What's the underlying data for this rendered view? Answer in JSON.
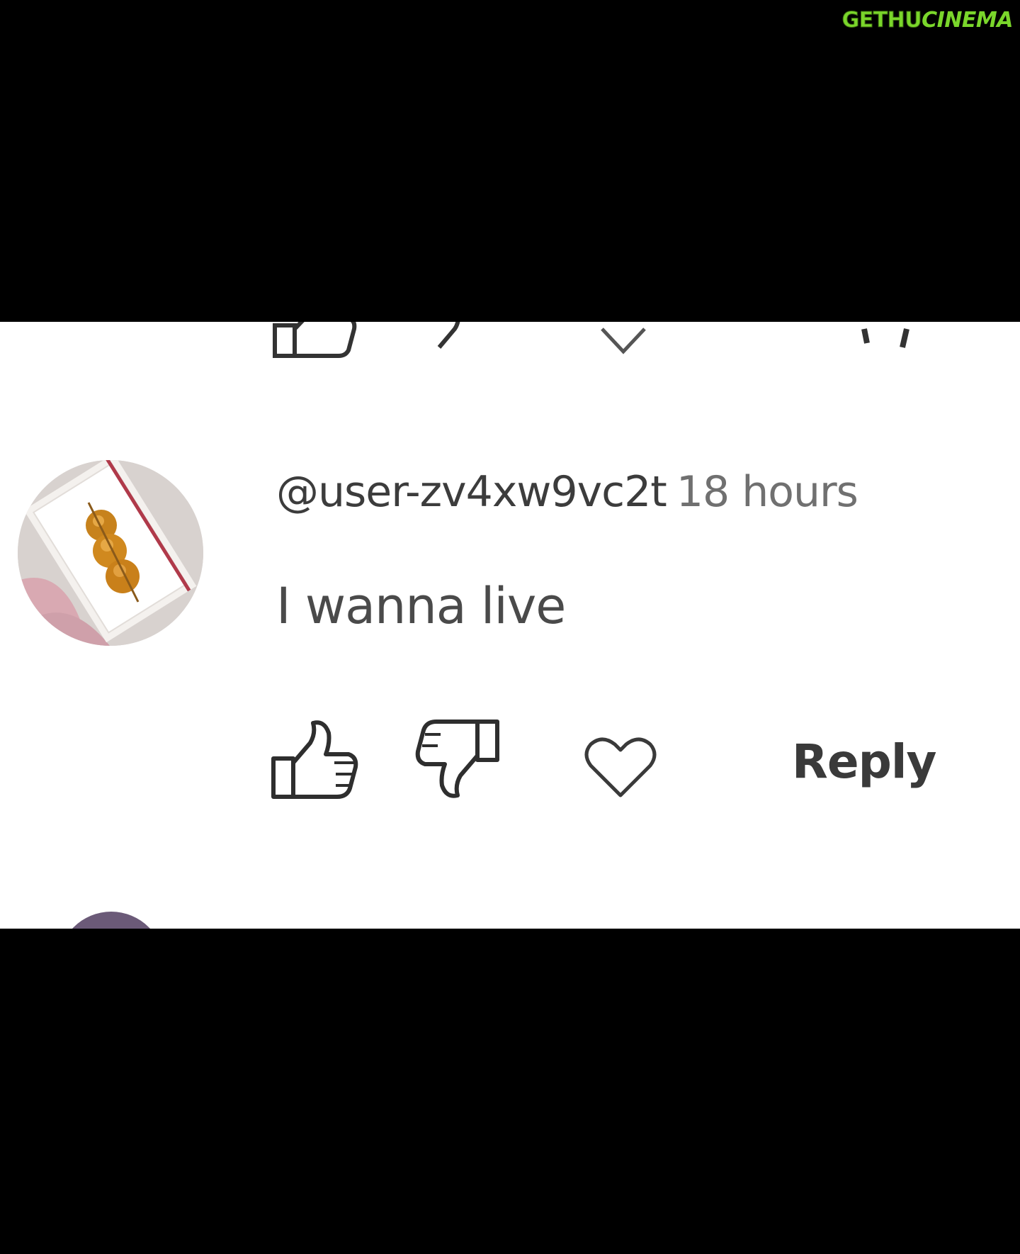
{
  "watermark": {
    "left": "GETHU",
    "right": "CINEMA"
  },
  "comment": {
    "username": "@user-zv4xw9vc2t",
    "timestamp": "18 hours",
    "text": "I wanna live",
    "avatar_icon": "avatar-image"
  },
  "actions": {
    "like_icon": "thumbs-up-icon",
    "dislike_icon": "thumbs-down-icon",
    "heart_icon": "heart-icon",
    "reply_label": "Reply"
  },
  "colors": {
    "background": "#ffffff",
    "letterbox": "#000000",
    "text_primary": "#3c3c3c",
    "text_secondary": "#707070",
    "watermark_green": "#7ad62b"
  }
}
